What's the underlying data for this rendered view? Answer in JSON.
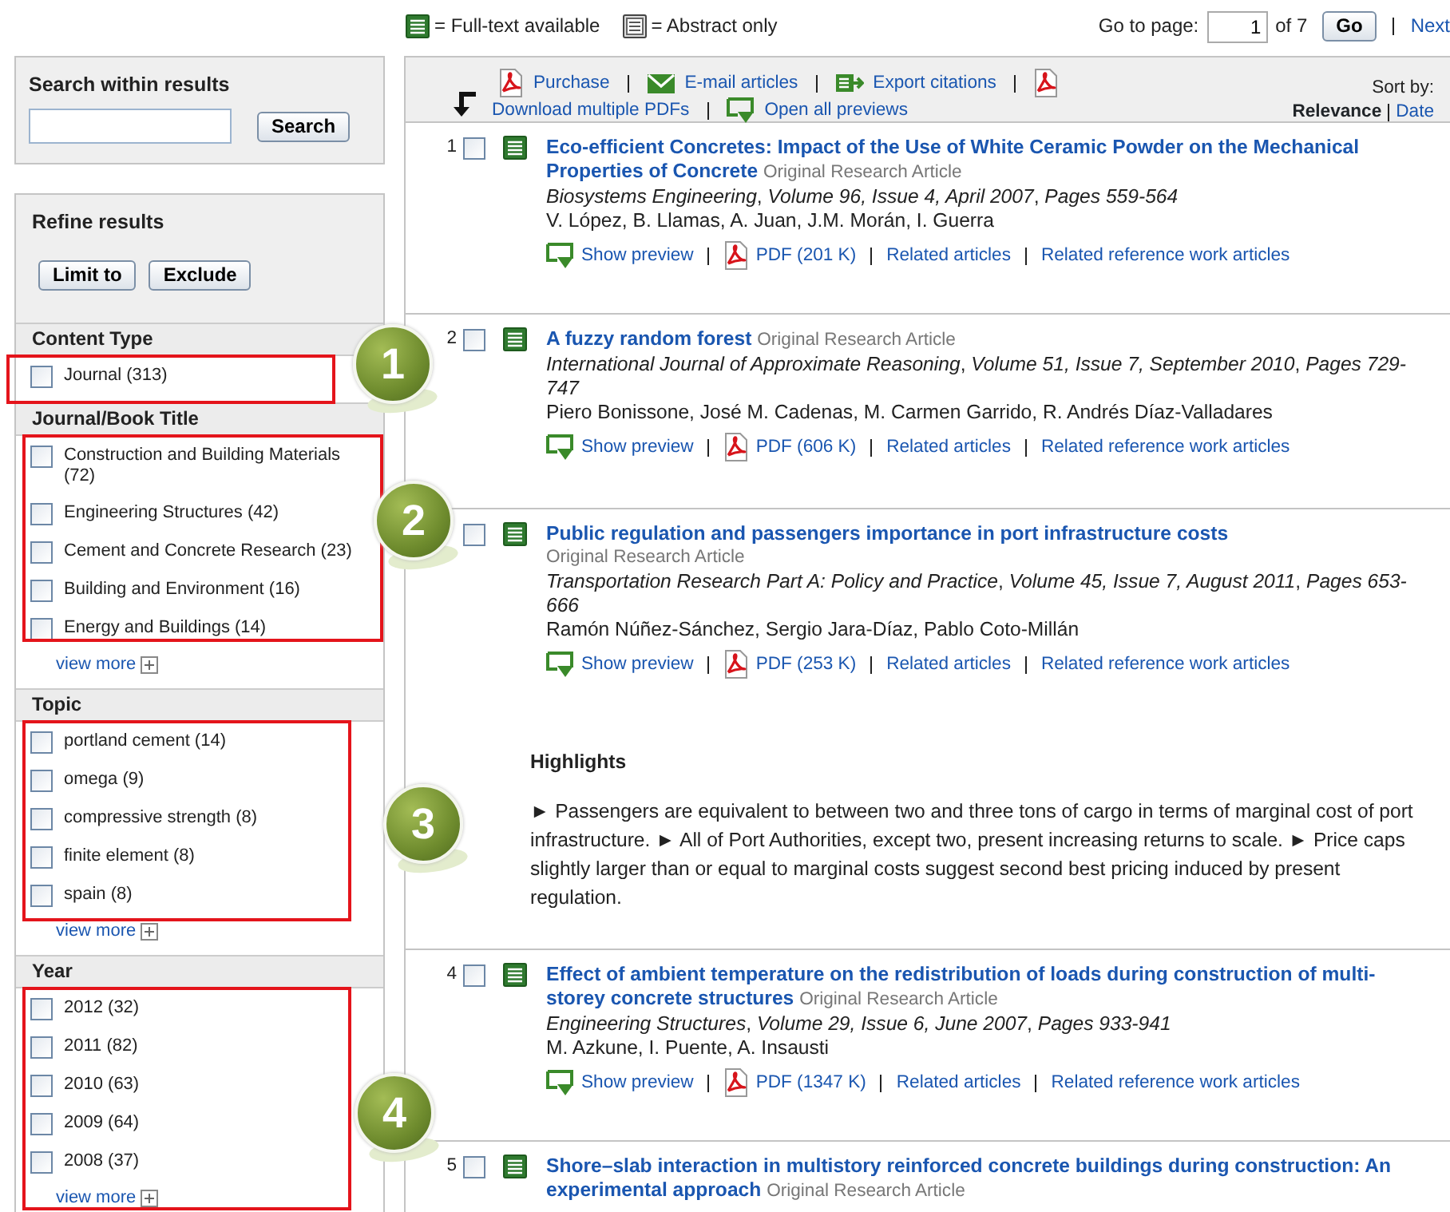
{
  "legend": [
    {
      "kind": "full",
      "label": "= Full-text available"
    },
    {
      "kind": "abstract",
      "label": "= Abstract only"
    }
  ],
  "pager": {
    "label": "Go to page:",
    "value": "1",
    "of": "of 7",
    "button": "Go",
    "next": "Next"
  },
  "search_box": {
    "title": "Search within results",
    "button": "Search"
  },
  "refine": {
    "title": "Refine results",
    "buttons": [
      "Limit to",
      "Exclude"
    ]
  },
  "facets": [
    {
      "title": "Content Type",
      "callout": "1",
      "items": [
        {
          "label": "Journal (313)",
          "checked": false
        }
      ]
    },
    {
      "title": "Journal/Book Title",
      "callout": "2",
      "view_more": "view more",
      "items": [
        {
          "label": "Construction and Building Materials (72)",
          "checked": false
        },
        {
          "label": "Engineering Structures (42)",
          "checked": false
        },
        {
          "label": "Cement and Concrete Research (23)",
          "checked": false
        },
        {
          "label": "Building and Environment (16)",
          "checked": false
        },
        {
          "label": "Energy and Buildings (14)",
          "checked": false
        }
      ]
    },
    {
      "title": "Topic",
      "callout": "3",
      "view_more": "view more",
      "items": [
        {
          "label": "portland cement (14)",
          "checked": false
        },
        {
          "label": "omega (9)",
          "checked": false
        },
        {
          "label": "compressive strength (8)",
          "checked": false
        },
        {
          "label": "finite element (8)",
          "checked": false
        },
        {
          "label": "spain (8)",
          "checked": false
        }
      ]
    },
    {
      "title": "Year",
      "callout": "4",
      "view_more": "view more",
      "items": [
        {
          "label": "2012 (32)",
          "checked": false
        },
        {
          "label": "2011 (82)",
          "checked": false
        },
        {
          "label": "2010 (63)",
          "checked": false
        },
        {
          "label": "2009 (64)",
          "checked": false
        },
        {
          "label": "2008 (37)",
          "checked": false
        }
      ]
    }
  ],
  "toolbar": {
    "actions": [
      {
        "kind": "pdf",
        "label": "Purchase"
      },
      {
        "kind": "email",
        "label": "E-mail articles"
      },
      {
        "kind": "export",
        "label": "Export citations"
      },
      {
        "kind": "pdf",
        "label": "Download multiple PDFs"
      },
      {
        "kind": "preview",
        "label": "Open all previews"
      }
    ],
    "sort_label": "Sort by:",
    "sort_options": [
      {
        "label": "Relevance",
        "selected": true
      },
      {
        "label": "Date",
        "selected": false
      }
    ]
  },
  "results": [
    {
      "number": "1",
      "checked": false,
      "kind": "full",
      "title": "Eco-efficient Concretes: Impact of the Use of White Ceramic Powder on the Mechanical Properties of Concrete",
      "type": "Original Research Article",
      "source": "*Biosystems Engineering*, *Volume 96, Issue 4, April 2007*, *Pages 559-564*",
      "authors": "V. López, B. Llamas, A. Juan, J.M. Morán, I. Guerra",
      "links": [
        {
          "kind": "preview",
          "label": "Show preview"
        },
        {
          "kind": "pdf",
          "label": "PDF (201 K)"
        },
        {
          "kind": "plain",
          "label": "Related articles"
        },
        {
          "kind": "plain",
          "label": "Related reference work articles"
        }
      ]
    },
    {
      "number": "2",
      "checked": false,
      "kind": "full",
      "title": "A fuzzy random forest",
      "type": "Original Research Article",
      "source": "*International Journal of Approximate Reasoning*, *Volume 51, Issue 7, September 2010*, *Pages 729-747*",
      "authors": "Piero Bonissone, José M. Cadenas, M. Carmen Garrido, R. Andrés Díaz-Valladares",
      "links": [
        {
          "kind": "preview",
          "label": "Show preview"
        },
        {
          "kind": "pdf",
          "label": "PDF (606 K)"
        },
        {
          "kind": "plain",
          "label": "Related articles"
        },
        {
          "kind": "plain",
          "label": "Related reference work articles"
        }
      ]
    },
    {
      "checked": false,
      "kind": "full",
      "title": "Public regulation and passengers importance in port infrastructure costs",
      "type": "Original Research Article",
      "type_break": true,
      "source": "*Transportation Research Part A: Policy and Practice*, *Volume 45, Issue 7, August 2011*, *Pages 653-666*",
      "authors": "Ramón Núñez-Sánchez, Sergio Jara-Díaz, Pablo Coto-Millán",
      "links": [
        {
          "kind": "preview",
          "label": "Show preview"
        },
        {
          "kind": "pdf",
          "label": "PDF (253 K)"
        },
        {
          "kind": "plain",
          "label": "Related articles"
        },
        {
          "kind": "plain",
          "label": "Related reference work articles"
        }
      ],
      "highlights": {
        "title": "Highlights",
        "text": "► Passengers are equivalent to between two and three tons of cargo in terms of marginal cost of port infrastructure. ► All of Port Authorities, except two, present increasing returns to scale. ► Price caps slightly larger than or equal to marginal costs suggest second best pricing induced by present regulation."
      }
    },
    {
      "number": "4",
      "checked": false,
      "kind": "full",
      "title": "Effect of ambient temperature on the redistribution of loads during construction of multi-storey concrete structures",
      "type": "Original Research Article",
      "source": "*Engineering Structures*, *Volume 29, Issue 6, June 2007*, *Pages 933-941*",
      "authors": "M. Azkune, I. Puente, A. Insausti",
      "links": [
        {
          "kind": "preview",
          "label": "Show preview"
        },
        {
          "kind": "pdf",
          "label": "PDF (1347 K)"
        },
        {
          "kind": "plain",
          "label": "Related articles"
        },
        {
          "kind": "plain",
          "label": "Related reference work articles"
        }
      ]
    },
    {
      "number": "5",
      "checked": false,
      "kind": "full",
      "title": "Shore–slab interaction in multistory reinforced concrete buildings during construction: An experimental approach",
      "type": "Original Research Article"
    }
  ]
}
